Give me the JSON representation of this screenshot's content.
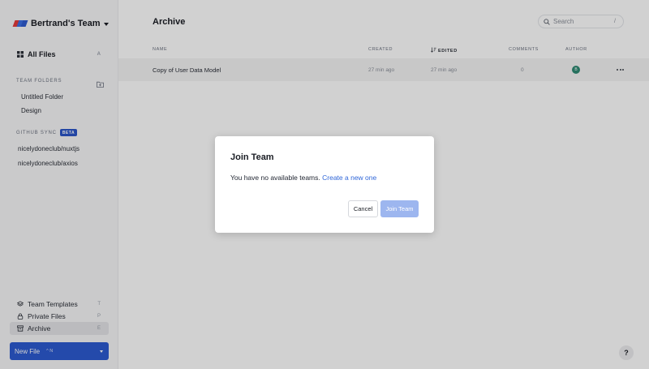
{
  "team": {
    "name": "Bertrand's Team"
  },
  "sidebar": {
    "all_files": {
      "label": "All Files",
      "shortcut": "A"
    },
    "team_folders": {
      "title": "TEAM FOLDERS",
      "items": [
        "Untitled Folder",
        "Design"
      ]
    },
    "github_sync": {
      "title": "GITHUB SYNC",
      "badge": "BETA",
      "items": [
        "nicelydoneclub/nuxtjs",
        "nicelydoneclub/axios"
      ]
    },
    "bottom_items": [
      {
        "label": "Team Templates",
        "shortcut": "T"
      },
      {
        "label": "Private Files",
        "shortcut": "P"
      },
      {
        "label": "Archive",
        "shortcut": "E"
      }
    ],
    "new_file": {
      "label": "New File",
      "keys": "^ N"
    }
  },
  "main": {
    "title": "Archive",
    "search": {
      "placeholder": "Search",
      "shortcut": "/"
    },
    "columns": {
      "name": "NAME",
      "created": "CREATED",
      "edited": "EDITED",
      "comments": "COMMENTS",
      "author": "AUTHOR"
    },
    "rows": [
      {
        "name": "Copy of User Data Model",
        "created": "27 min ago",
        "edited": "27 min ago",
        "comments": "0",
        "author_initial": "B"
      }
    ]
  },
  "dialog": {
    "title": "Join Team",
    "message": "You have no available teams.",
    "link": "Create a new one",
    "cancel_label": "Cancel",
    "join_label": "Join Team"
  },
  "help": {
    "label": "?"
  },
  "colors": {
    "accent": "#2d5bd1",
    "join_disabled": "#9db6ef",
    "avatar": "#2f8a73",
    "link": "#2f66d8"
  }
}
